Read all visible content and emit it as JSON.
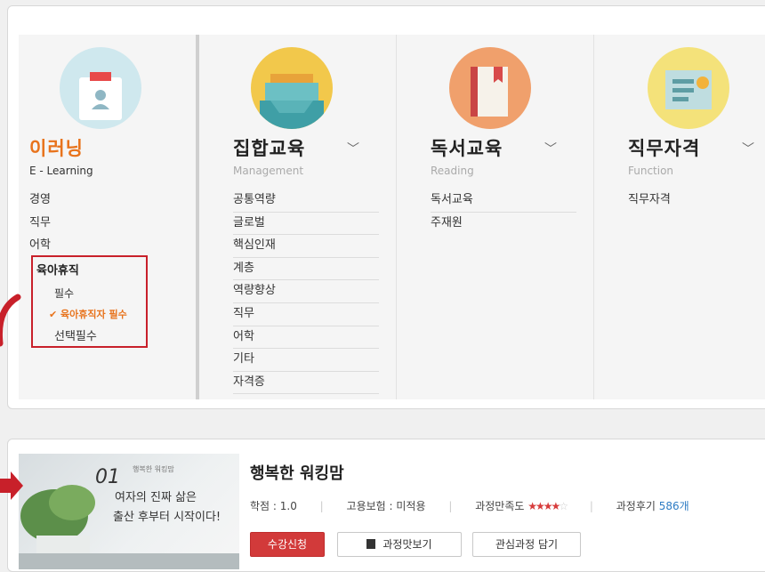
{
  "categories": [
    {
      "title": "이러닝",
      "subtitle": "E - Learning",
      "icon": "id-badge-icon",
      "items": [
        "경영",
        "직무",
        "어학"
      ],
      "highlight": {
        "label": "육아휴직",
        "subitems": [
          "필수",
          "✔ 육아휴직자 필수",
          "선택필수"
        ]
      }
    },
    {
      "title": "집합교육",
      "subtitle": "Management",
      "icon": "tray-icon",
      "items": [
        "공통역량",
        "글로벌",
        "핵심인재",
        "계층",
        "역량향상",
        "직무",
        "어학",
        "기타",
        "자격증"
      ]
    },
    {
      "title": "독서교육",
      "subtitle": "Reading",
      "icon": "book-icon",
      "items": [
        "독서교육",
        "주재원"
      ]
    },
    {
      "title": "직무자격",
      "subtitle": "Function",
      "icon": "certificate-icon",
      "items": [
        "직무자격"
      ]
    }
  ],
  "course": {
    "title": "행복한 워킹맘",
    "thumbnail": {
      "number": "01",
      "small_text": "행복한 워킹맘",
      "line1": "여자의 진짜 삶은",
      "line2": "출산 후부터 시작이다!"
    },
    "credit": "학점 : 1.0",
    "insurance": "고용보험 : 미적용",
    "satisfaction_label": "과정만족도",
    "rating": 4,
    "rating_max": 5,
    "review_label": "과정후기",
    "review_count": "586개",
    "buttons": {
      "enroll": "수강신청",
      "preview": "과정맛보기",
      "wishlist": "관심과정 담기"
    }
  },
  "colors": {
    "accent_orange": "#e8731c",
    "highlight_red": "#c8202a",
    "enroll_red": "#d23a3a",
    "link_blue": "#2e7cc4"
  }
}
